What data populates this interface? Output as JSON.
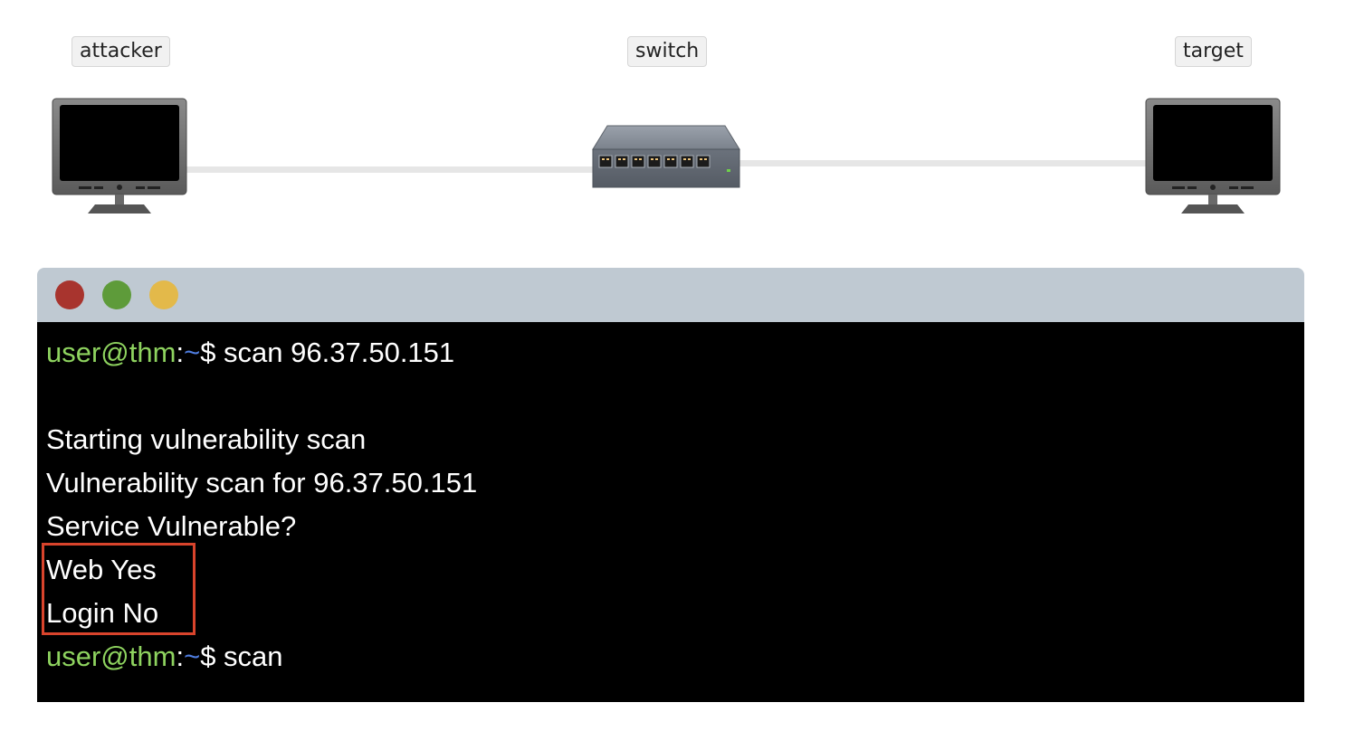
{
  "network": {
    "nodes": [
      {
        "label": "attacker",
        "icon": "monitor-icon"
      },
      {
        "label": "switch",
        "icon": "network-switch-icon"
      },
      {
        "label": "target",
        "icon": "monitor-icon"
      }
    ]
  },
  "terminal": {
    "window_controls": {
      "close_color": "#a8342e",
      "minimize_color": "#5e9b3a",
      "maximize_color": "#e3b94a"
    },
    "prompt": {
      "user_host": "user@thm",
      "separator": ":",
      "path": "~",
      "symbol": "$"
    },
    "lines": [
      {
        "type": "command",
        "text": " scan 96.37.50.151"
      },
      {
        "type": "output",
        "text": "Starting vulnerability scan"
      },
      {
        "type": "output",
        "text": "Vulnerability scan for 96.37.50.151"
      },
      {
        "type": "output",
        "text": "Service Vulnerable?"
      },
      {
        "type": "output",
        "text": "Web Yes"
      },
      {
        "type": "output",
        "text": "Login No"
      },
      {
        "type": "command",
        "text": " scan"
      }
    ]
  },
  "colors": {
    "prompt_user": "#8ed35f",
    "prompt_path": "#4f7de0",
    "highlight": "#d9442c",
    "terminal_bg": "#000000",
    "titlebar_bg": "#bfc9d2"
  }
}
